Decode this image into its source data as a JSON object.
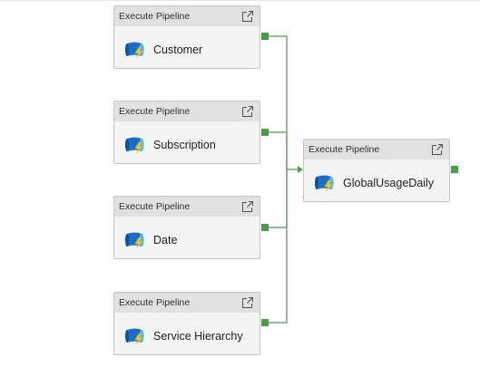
{
  "canvas": {
    "activities": [
      {
        "type": "Execute Pipeline",
        "name": "Customer"
      },
      {
        "type": "Execute Pipeline",
        "name": "Subscription"
      },
      {
        "type": "Execute Pipeline",
        "name": "Date"
      },
      {
        "type": "Execute Pipeline",
        "name": "Service Hierarchy"
      },
      {
        "type": "Execute Pipeline",
        "name": "GlobalUsageDaily"
      }
    ],
    "connector_color": "#4a9a4a",
    "icons": {
      "open": "open-in-new-icon",
      "pipeline": "execute-pipeline-icon"
    }
  }
}
